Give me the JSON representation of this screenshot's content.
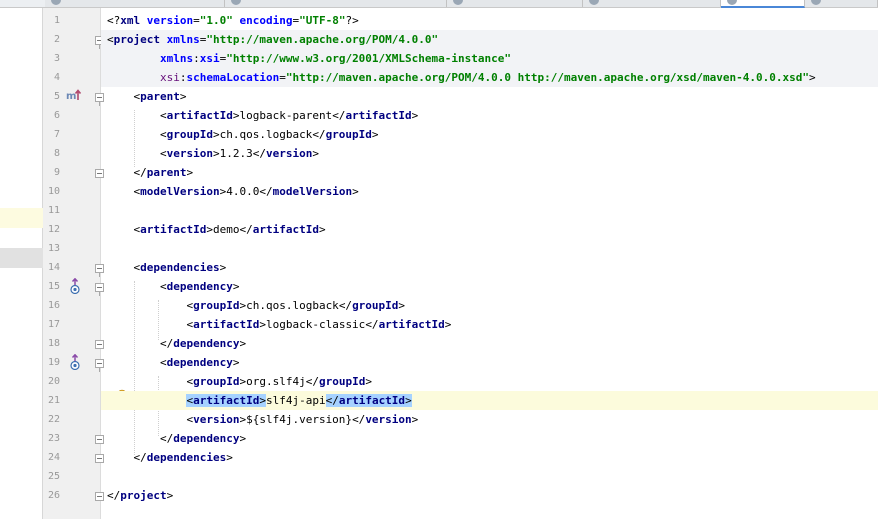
{
  "editor": {
    "tabs": [
      {
        "label": "",
        "active": false
      },
      {
        "label": "",
        "active": false
      },
      {
        "label": "",
        "active": false
      },
      {
        "label": "",
        "active": false
      },
      {
        "label": "",
        "active": false
      },
      {
        "label": "",
        "active": true
      },
      {
        "label": "",
        "active": false
      }
    ],
    "line_numbers": [
      "1",
      "2",
      "3",
      "4",
      "5",
      "6",
      "7",
      "8",
      "9",
      "10",
      "11",
      "12",
      "13",
      "14",
      "15",
      "16",
      "17",
      "18",
      "19",
      "20",
      "21",
      "22",
      "23",
      "24",
      "25",
      "26"
    ],
    "code": {
      "l1_open": "<?",
      "l1_tag": "xml",
      "l1_a1": "version",
      "l1_eq1": "=",
      "l1_v1": "\"1.0\"",
      "l1_a2": "encoding",
      "l1_eq2": "=",
      "l1_v2": "\"UTF-8\"",
      "l1_close": "?>",
      "project": "project",
      "xmlns": "xmlns",
      "xmlns_val": "\"http://maven.apache.org/POM/4.0.0\"",
      "xmlns_xsi_prefix": "xmlns",
      "xmlns_xsi_name": "xsi",
      "xsi_val": "\"http://www.w3.org/2001/XMLSchema-instance\"",
      "xsi_prefix": "xsi",
      "schema_loc": "schemaLocation",
      "schema_val": "\"http://maven.apache.org/POM/4.0.0 http://maven.apache.org/xsd/maven-4.0.0.xsd\"",
      "parent": "parent",
      "artifactId": "artifactId",
      "groupId": "groupId",
      "version": "version",
      "modelVersion": "modelVersion",
      "dependencies": "dependencies",
      "dependency": "dependency",
      "logback_parent": "logback-parent",
      "ch_qos_logback": "ch.qos.logback",
      "v123": "1.2.3",
      "model_ver": "4.0.0",
      "demo": "demo",
      "logback_classic": "logback-classic",
      "org_slf4j": "org.slf4j",
      "slf4j_api": "slf4j-api",
      "slf4j_version": "${slf4j.version}"
    }
  }
}
